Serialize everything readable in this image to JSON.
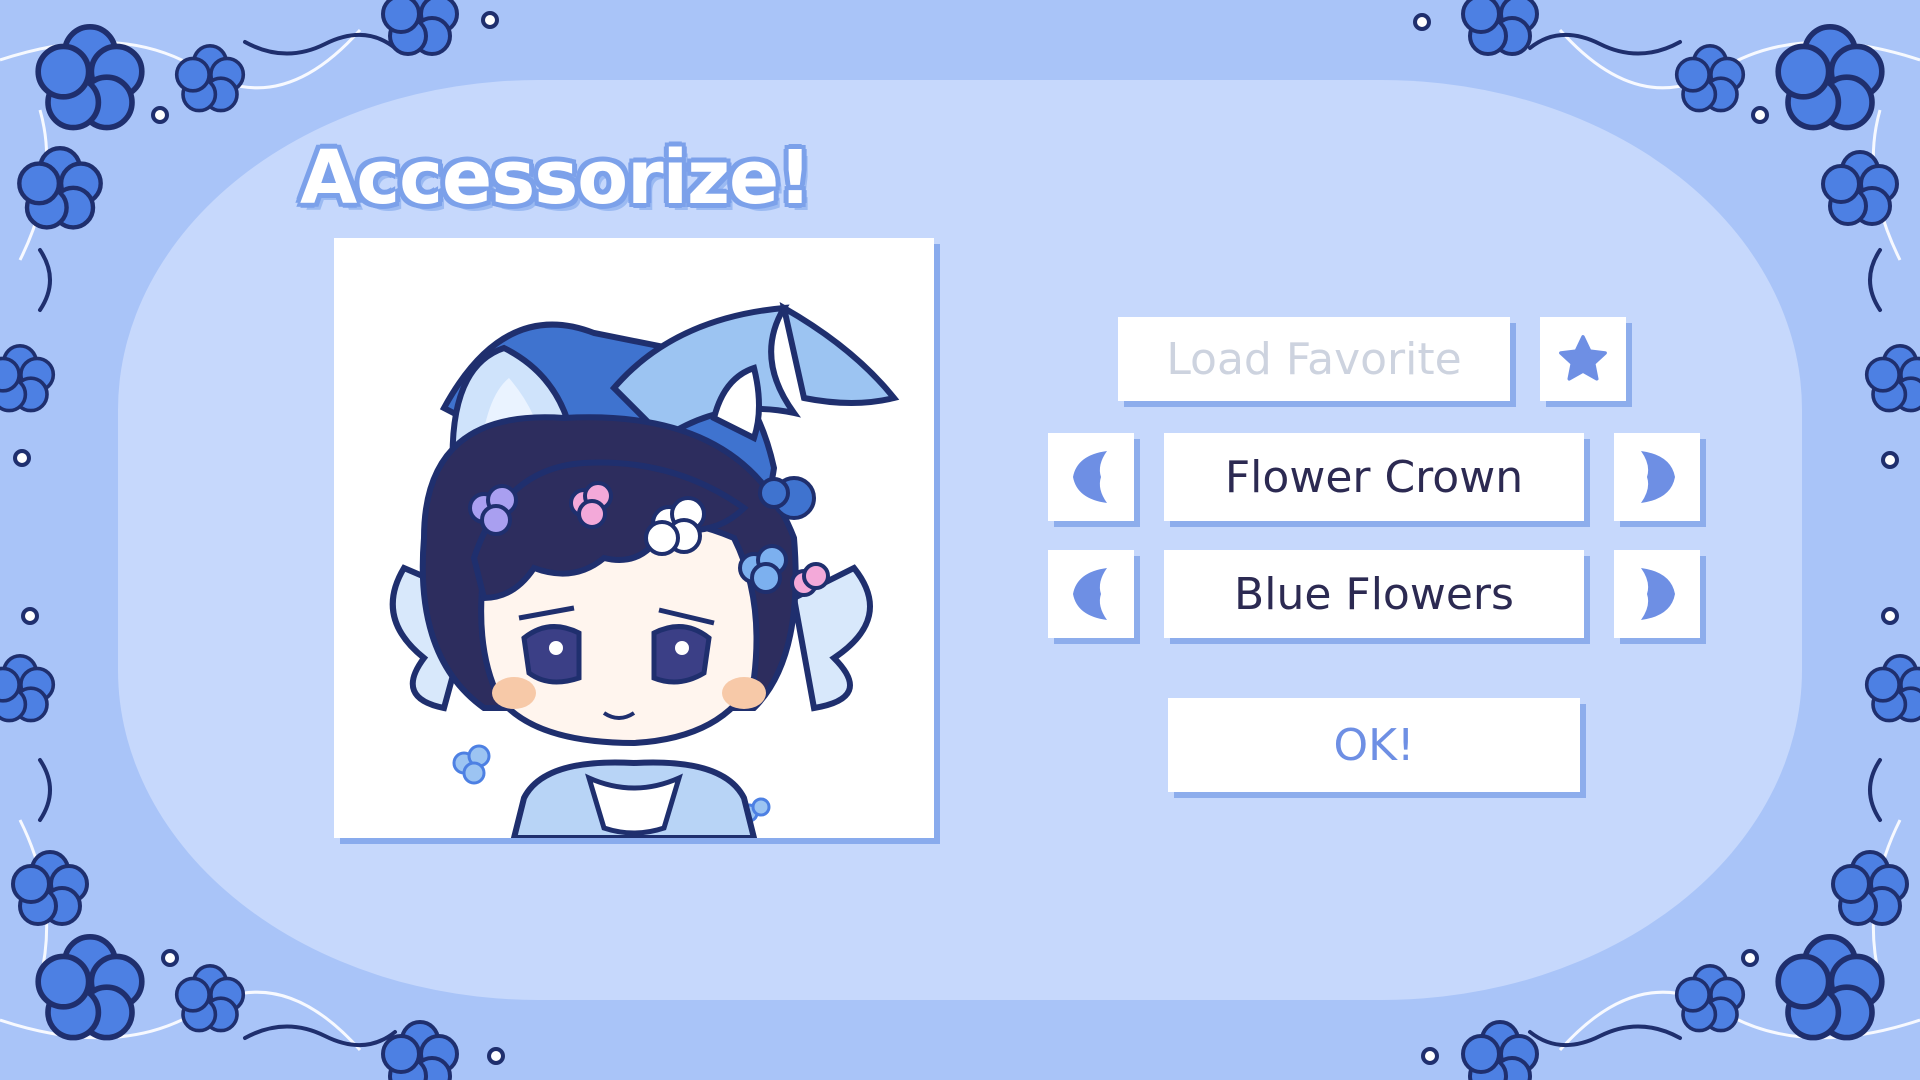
{
  "screen": {
    "title": "Accessorize!"
  },
  "favorites": {
    "load_label": "Load Favorite",
    "star_icon": "star-icon"
  },
  "selectors": [
    {
      "value": "Flower Crown",
      "prev_icon": "arrow-left-icon",
      "next_icon": "arrow-right-icon"
    },
    {
      "value": "Blue Flowers",
      "prev_icon": "arrow-left-icon",
      "next_icon": "arrow-right-icon"
    }
  ],
  "confirm": {
    "ok_label": "OK!"
  },
  "colors": {
    "background": "#a9c4f8",
    "panel": "#c6d8fc",
    "accent": "#6e8fe4",
    "flower": "#4d80e3",
    "outline": "#1f2f6e"
  }
}
